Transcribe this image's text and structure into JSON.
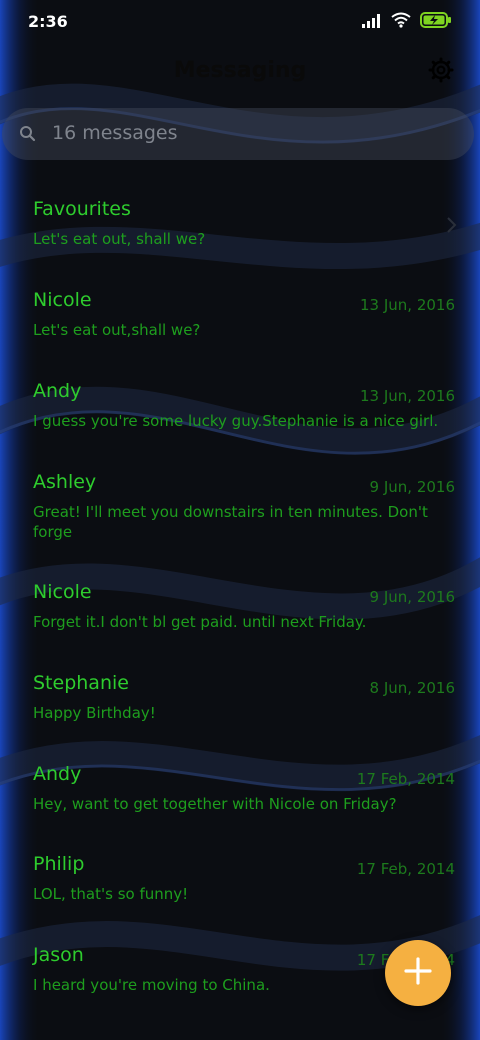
{
  "status_bar": {
    "time": "2:36",
    "icons": [
      "signal-icon",
      "wifi-icon",
      "battery-charging-icon"
    ]
  },
  "header": {
    "title": "Messaging",
    "settings_icon": "gear-icon"
  },
  "search": {
    "placeholder": "16 messages",
    "icon": "search-icon"
  },
  "conversations": [
    {
      "name": "Favourites",
      "date": "",
      "preview": "Let's eat out, shall we?",
      "has_chevron": true
    },
    {
      "name": "Nicole",
      "date": "13 Jun, 2016",
      "preview": "Let's eat out,shall we?"
    },
    {
      "name": "Andy",
      "date": "13 Jun, 2016",
      "preview": "I guess you're some lucky guy.Stephanie is a nice girl."
    },
    {
      "name": "Ashley",
      "date": "9 Jun, 2016",
      "preview": "Great! I'll meet you downstairs in ten minutes. Don't forge"
    },
    {
      "name": "Nicole",
      "date": "9 Jun, 2016",
      "preview": "Forget it.I don't bl get paid. until next Friday."
    },
    {
      "name": "Stephanie",
      "date": "8 Jun, 2016",
      "preview": "Happy Birthday!"
    },
    {
      "name": "Andy",
      "date": "17 Feb, 2014",
      "preview": "Hey, want to get together with Nicole on Friday?"
    },
    {
      "name": "Philip",
      "date": "17 Feb, 2014",
      "preview": "LOL, that's so funny!"
    },
    {
      "name": "Jason",
      "date": "17 Feb, 2014",
      "preview": "I heard you're moving to China."
    }
  ],
  "fab": {
    "icon": "plus-icon"
  },
  "colors": {
    "accent_green": "#2ecc2e",
    "date_green": "#1d7a1d",
    "fab_orange": "#f5b041",
    "battery_green": "#7ed321",
    "edge_blue": "#1c4fd8"
  }
}
